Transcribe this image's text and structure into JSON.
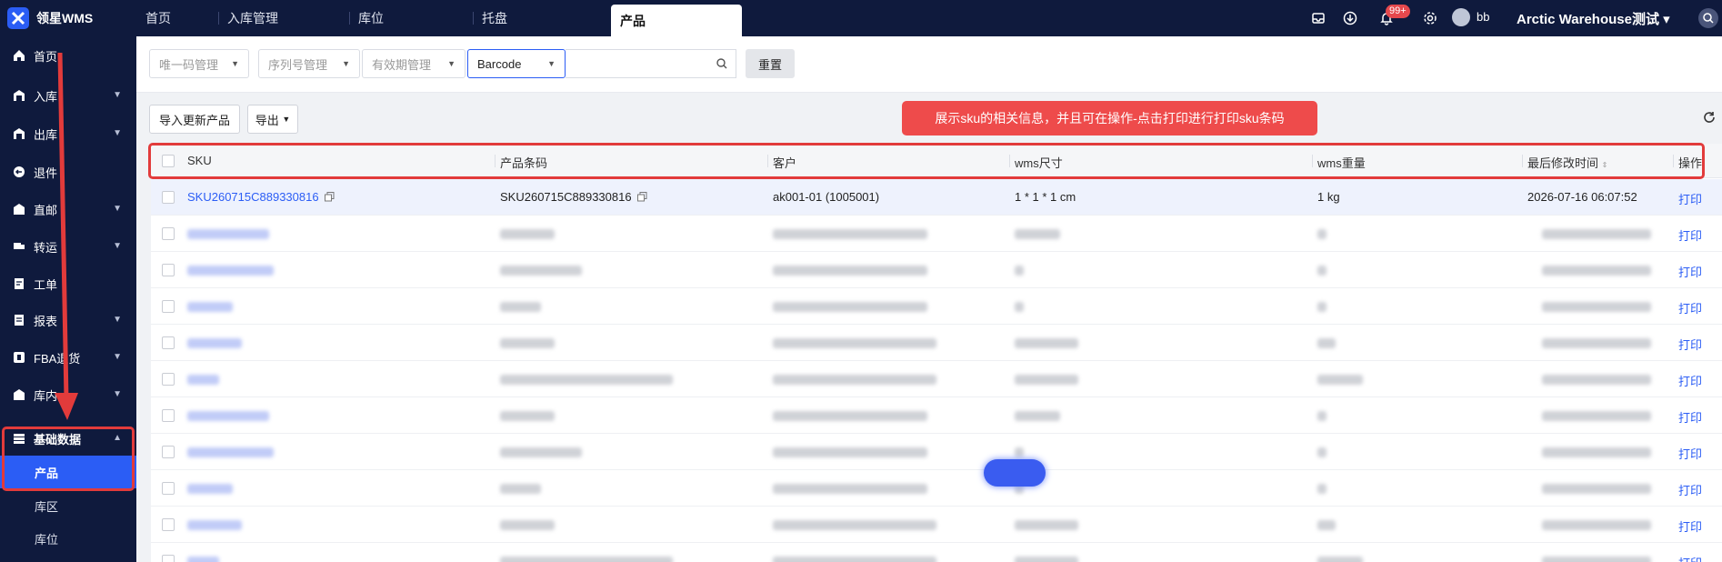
{
  "header": {
    "app_name": "领星WMS",
    "tabs": [
      "首页",
      "入库管理",
      "库位",
      "托盘",
      "产品"
    ],
    "active_tab": "产品",
    "notification_badge": "99+",
    "username": "bb",
    "warehouse": "Arctic Warehouse测试"
  },
  "sidebar": {
    "items": [
      {
        "label": "首页",
        "icon": "home-icon",
        "has_chevron": false
      },
      {
        "label": "入库",
        "icon": "inbound-icon",
        "has_chevron": true
      },
      {
        "label": "出库",
        "icon": "outbound-icon",
        "has_chevron": true
      },
      {
        "label": "退件",
        "icon": "return-icon",
        "has_chevron": false
      },
      {
        "label": "直邮",
        "icon": "direct-mail-icon",
        "has_chevron": true
      },
      {
        "label": "转运",
        "icon": "transfer-icon",
        "has_chevron": true
      },
      {
        "label": "工单",
        "icon": "work-order-icon",
        "has_chevron": false
      },
      {
        "label": "报表",
        "icon": "report-icon",
        "has_chevron": true
      },
      {
        "label": "FBA退货",
        "icon": "fba-icon",
        "has_chevron": true
      },
      {
        "label": "库内",
        "icon": "inventory-icon",
        "has_chevron": true
      },
      {
        "label": "基础数据",
        "icon": "data-icon",
        "has_chevron": true
      }
    ],
    "sub_items": [
      "产品",
      "库区",
      "库位"
    ],
    "active_sub": "产品"
  },
  "filters": {
    "unique_code": "唯一码管理",
    "serial_number": "序列号管理",
    "expiry": "有效期管理",
    "search_field": "Barcode",
    "search_value": "",
    "reset_label": "重置"
  },
  "toolbar": {
    "import_label": "导入更新产品",
    "export_label": "导出"
  },
  "annotation": {
    "callout_text": "展示sku的相关信息，并且可在操作-点击打印进行打印sku条码"
  },
  "table": {
    "columns": [
      "SKU",
      "产品条码",
      "客户",
      "wms尺寸",
      "wms重量",
      "最后修改时间",
      "操作"
    ],
    "first_row": {
      "sku": "SKU260715C889330816",
      "barcode": "SKU260715C889330816",
      "customer": "ak001-01 (1005001)",
      "size": "1 * 1 * 1 cm",
      "weight": "1 kg",
      "modified": "2026-07-16 06:07:52",
      "action": "打印"
    },
    "action_label": "打印",
    "blurred_row_count": 10
  },
  "colors": {
    "nav_bg": "#0f1a3d",
    "accent": "#2b5df5",
    "annotation_red": "#e23b3b"
  }
}
